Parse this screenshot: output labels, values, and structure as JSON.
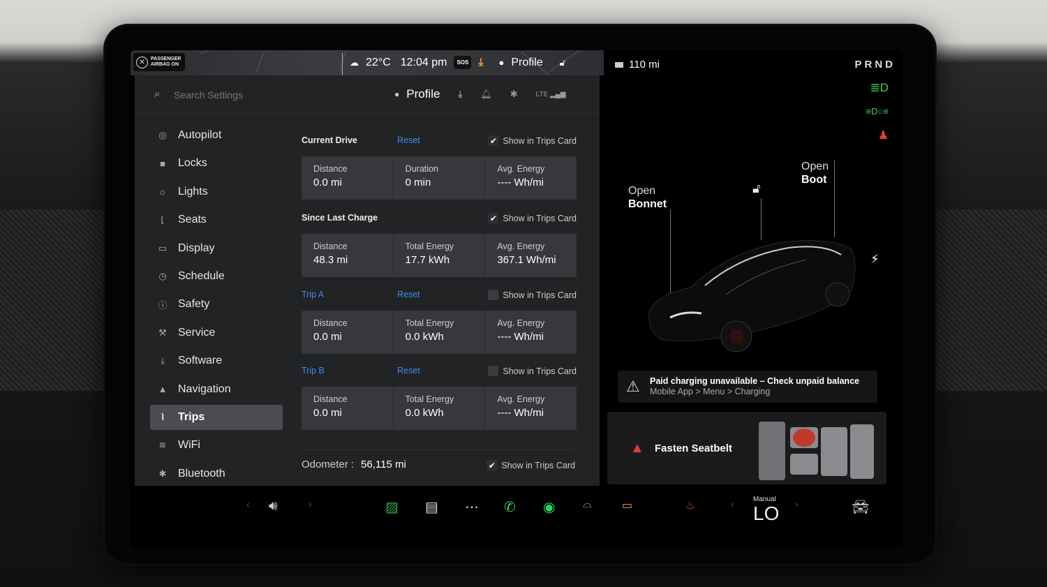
{
  "status_bar": {
    "airbag_line1": "PASSENGER",
    "airbag_line2": "AIRBAG ON",
    "temperature": "22°C",
    "time": "12:04 pm",
    "sos": "SOS",
    "profile": "Profile"
  },
  "header": {
    "search_placeholder": "Search Settings",
    "profile": "Profile"
  },
  "nav": {
    "items": [
      {
        "label": "Autopilot",
        "icon": "steering-wheel-icon"
      },
      {
        "label": "Locks",
        "icon": "lock-icon"
      },
      {
        "label": "Lights",
        "icon": "light-icon"
      },
      {
        "label": "Seats",
        "icon": "seat-icon"
      },
      {
        "label": "Display",
        "icon": "display-icon"
      },
      {
        "label": "Schedule",
        "icon": "clock-icon"
      },
      {
        "label": "Safety",
        "icon": "info-icon"
      },
      {
        "label": "Service",
        "icon": "wrench-icon"
      },
      {
        "label": "Software",
        "icon": "download-icon"
      },
      {
        "label": "Navigation",
        "icon": "navigation-arrow-icon"
      },
      {
        "label": "Trips",
        "icon": "trips-icon",
        "active": true
      },
      {
        "label": "WiFi",
        "icon": "wifi-icon"
      },
      {
        "label": "Bluetooth",
        "icon": "bluetooth-icon"
      }
    ]
  },
  "trips": {
    "show_in_trips_card": "Show in Trips Card",
    "reset": "Reset",
    "current_drive": {
      "title": "Current Drive",
      "checked": true,
      "cells": [
        {
          "label": "Distance",
          "value": "0.0 mi"
        },
        {
          "label": "Duration",
          "value": "0 min"
        },
        {
          "label": "Avg. Energy",
          "value": "---- Wh/mi"
        }
      ]
    },
    "since_last_charge": {
      "title": "Since Last Charge",
      "checked": true,
      "cells": [
        {
          "label": "Distance",
          "value": "48.3 mi"
        },
        {
          "label": "Total Energy",
          "value": "17.7 kWh"
        },
        {
          "label": "Avg. Energy",
          "value": "367.1 Wh/mi"
        }
      ]
    },
    "trip_a": {
      "title": "Trip A",
      "checked": false,
      "cells": [
        {
          "label": "Distance",
          "value": "0.0 mi"
        },
        {
          "label": "Total Energy",
          "value": "0.0 kWh"
        },
        {
          "label": "Avg. Energy",
          "value": "---- Wh/mi"
        }
      ]
    },
    "trip_b": {
      "title": "Trip B",
      "checked": false,
      "cells": [
        {
          "label": "Distance",
          "value": "0.0 mi"
        },
        {
          "label": "Total Energy",
          "value": "0.0 kWh"
        },
        {
          "label": "Avg. Energy",
          "value": "---- Wh/mi"
        }
      ]
    },
    "odometer_label": "Odometer :",
    "odometer_value": "56,115 mi",
    "odometer_checked": true
  },
  "car": {
    "range": "110 mi",
    "gear": "PRND",
    "open_bonnet_1": "Open",
    "open_bonnet_2": "Bonnet",
    "open_boot_1": "Open",
    "open_boot_2": "Boot",
    "alert_title": "Paid charging unavailable – Check unpaid balance",
    "alert_sub": "Mobile App > Menu > Charging",
    "seatbelt": "Fasten Seatbelt"
  },
  "dock": {
    "climate_mode": "Manual",
    "climate_value": "LO"
  },
  "colors": {
    "accent_blue": "#3d8df5",
    "warning_red": "#e23b3b",
    "download_orange": "#f0a03a",
    "indicator_green": "#3ecf5a"
  }
}
